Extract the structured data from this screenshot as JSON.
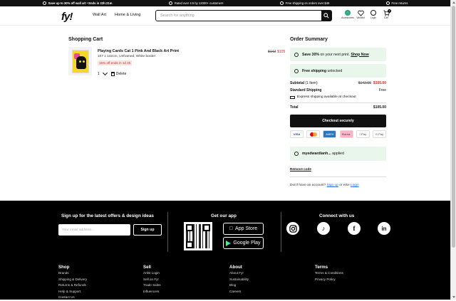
{
  "topbar": {
    "promo": "Save up to 30% off wall art • Ends in 22h:21m",
    "rated": "Rated over 4.5 by 12000+ customers",
    "shipping": "Free shipping on orders over $49",
    "returns": "Free returns"
  },
  "header": {
    "logo": "fy!",
    "nav": [
      "Wall Art",
      "Home & Living"
    ],
    "search_placeholder": "Search for anything",
    "icons": [
      {
        "label": "Accessories",
        "icon": "globe-icon"
      },
      {
        "label": "Wishlist",
        "icon": "heart-icon"
      },
      {
        "label": "Login",
        "icon": "user-icon"
      },
      {
        "label": "Cart",
        "icon": "cart-icon",
        "badge": "1"
      }
    ]
  },
  "cart": {
    "title": "Shopping Cart",
    "item": {
      "name": "Playing Cards Cat 1 Pink And Black Art Print",
      "desc": "107 x 142cm, Unframed, White border",
      "promo": "15% off ends in 1d 4h",
      "qty": "1",
      "delete": "Delete",
      "old_price": "$142",
      "new_price": "$105"
    }
  },
  "summary": {
    "title": "Order Summary",
    "save_prefix": "Save 30%",
    "save_mid": " on your next print. ",
    "save_link": "Shop Now",
    "free_ship_bold": "Free shipping",
    "free_ship_rest": " unlocked",
    "subtotal_label": "Subtotal",
    "subtotal_items": "(1 Item)",
    "subtotal_old": "$142.00",
    "subtotal_new": "$105.00",
    "std_ship_label": "Standard Shipping",
    "std_ship_value": "Free",
    "express": "Express shipping available at checkout",
    "total_label": "Total",
    "total_value": "$105.00",
    "checkout": "Checkout securely",
    "payments": [
      "VISA",
      "Mastercard",
      "Amex",
      "Klarna",
      "Apple Pay",
      "G Pay"
    ],
    "coupon_code": "myedwardianh...",
    "coupon_status": " applied",
    "remove_code": "Remove code",
    "account_text": "Don't have an account? ",
    "signup": "Sign up",
    "or": " or else ",
    "login": "Login"
  },
  "footer": {
    "newsletter_title": "Sign up for the latest offers & design ideas",
    "email_placeholder": "Your email address...",
    "signup_button": "Sign up",
    "app_title": "Get our app",
    "app_store": "App Store",
    "google_play": "Google Play",
    "connect_title": "Connect with us",
    "columns": [
      {
        "title": "Shop",
        "links": [
          "Brands",
          "Shipping & Delivery",
          "Returns & Refunds",
          "Help & Support",
          "Contact Us"
        ]
      },
      {
        "title": "Sell",
        "links": [
          "Artist Login",
          "Sell on Fy!",
          "Trade Sales",
          "Influencers"
        ]
      },
      {
        "title": "About",
        "links": [
          "About Fy!",
          "Sustainability",
          "Blog",
          "Careers"
        ]
      },
      {
        "title": "Terms",
        "links": [
          "Terms & Conditions",
          "Privacy Policy"
        ]
      }
    ]
  }
}
